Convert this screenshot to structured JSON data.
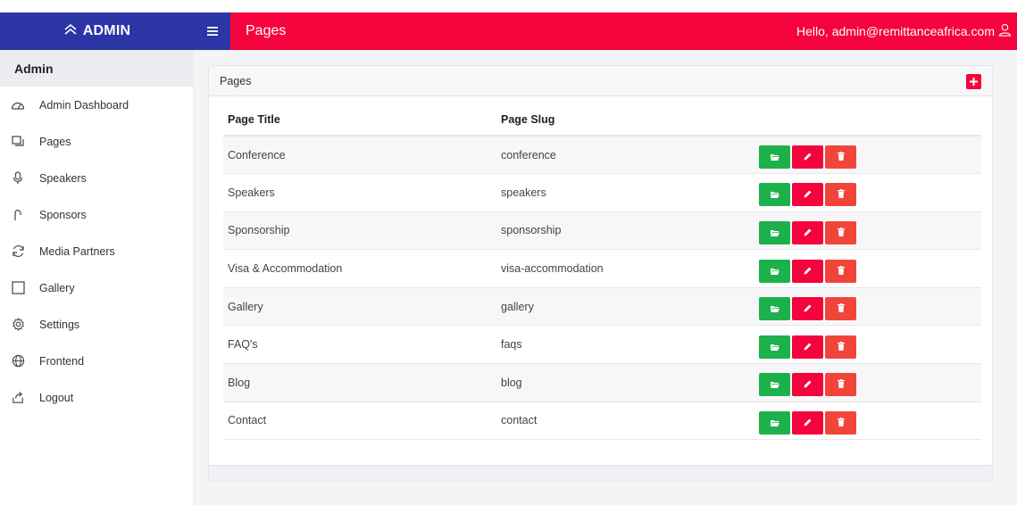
{
  "colors": {
    "brand": "#2b35a6",
    "header": "#f5033c",
    "view": "#1db14b",
    "edit": "#f5033c",
    "delete": "#f2453a"
  },
  "brand": {
    "label": "ADMIN",
    "icon": "double-chevron-up-icon"
  },
  "header": {
    "menu_icon": "hamburger-icon",
    "title": "Pages",
    "greeting": "Hello, admin@remittanceafrica.com",
    "user_icon": "user-icon"
  },
  "sidebar": {
    "heading": "Admin",
    "items": [
      {
        "label": "Admin Dashboard",
        "icon": "dashboard-icon"
      },
      {
        "label": "Pages",
        "icon": "pages-icon"
      },
      {
        "label": "Speakers",
        "icon": "microphone-icon"
      },
      {
        "label": "Sponsors",
        "icon": "hand-icon"
      },
      {
        "label": "Media Partners",
        "icon": "refresh-icon"
      },
      {
        "label": "Gallery",
        "icon": "square-icon"
      },
      {
        "label": "Settings",
        "icon": "gear-icon"
      },
      {
        "label": "Frontend",
        "icon": "globe-icon"
      },
      {
        "label": "Logout",
        "icon": "share-icon"
      }
    ]
  },
  "card": {
    "title": "Pages",
    "add_icon": "plus-icon",
    "columns": [
      "Page Title",
      "Page Slug",
      ""
    ],
    "rows": [
      {
        "title": "Conference",
        "slug": "conference"
      },
      {
        "title": "Speakers",
        "slug": "speakers"
      },
      {
        "title": "Sponsorship",
        "slug": "sponsorship"
      },
      {
        "title": "Visa & Accommodation",
        "slug": "visa-accommodation"
      },
      {
        "title": "Gallery",
        "slug": "gallery"
      },
      {
        "title": "FAQ's",
        "slug": "faqs"
      },
      {
        "title": "Blog",
        "slug": "blog"
      },
      {
        "title": "Contact",
        "slug": "contact"
      }
    ],
    "row_actions": {
      "view_icon": "folder-open-icon",
      "edit_icon": "pencil-icon",
      "delete_icon": "trash-icon"
    }
  }
}
